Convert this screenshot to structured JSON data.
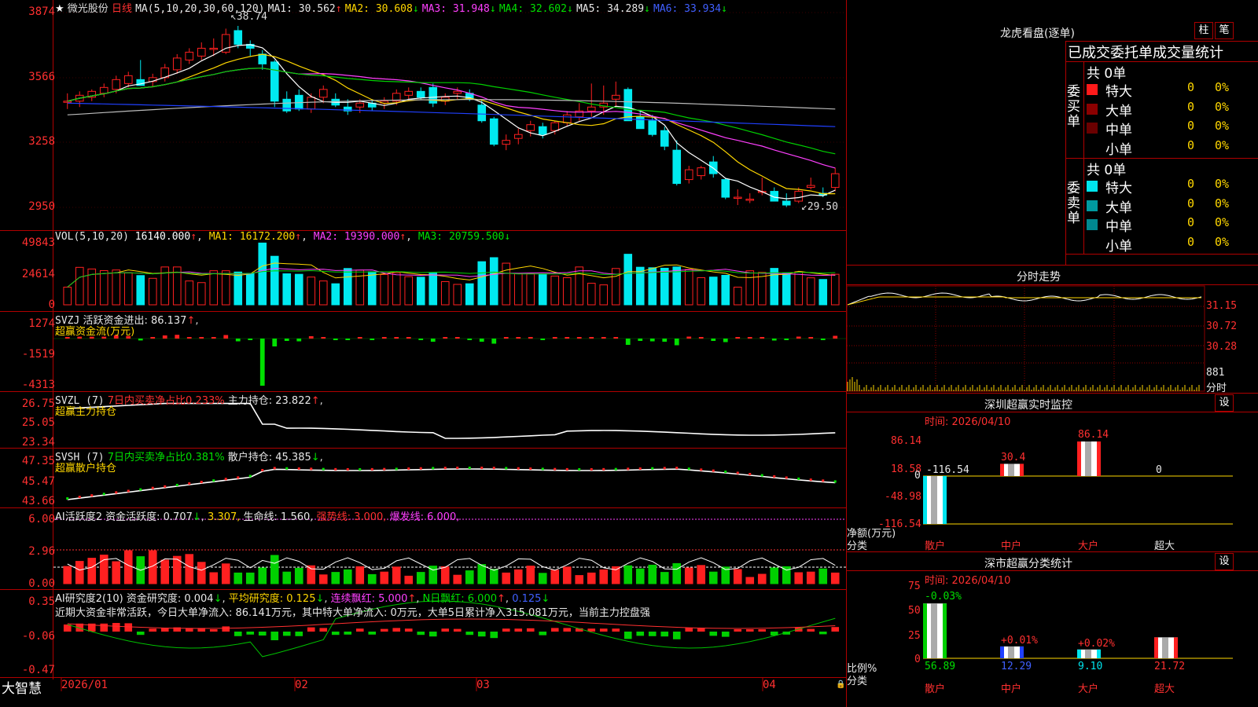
{
  "header": {
    "stock_name": "微光股份",
    "period": "日线",
    "ma_params": "MA(5,10,20,30,60,120)",
    "ma": [
      {
        "label": "MA1:",
        "value": "30.562",
        "arrow": "↑"
      },
      {
        "label": "MA2:",
        "value": "30.608",
        "arrow": "↓"
      },
      {
        "label": "MA3:",
        "value": "31.948",
        "arrow": "↓"
      },
      {
        "label": "MA4:",
        "value": "32.602",
        "arrow": "↓"
      },
      {
        "label": "MA5:",
        "value": "34.289",
        "arrow": "↓"
      },
      {
        "label": "MA6:",
        "value": "33.934",
        "arrow": "↓"
      }
    ],
    "high_marker": "38.74",
    "low_marker": "29.50"
  },
  "price_axis": [
    "3874",
    "3566",
    "3258",
    "2950"
  ],
  "vol": {
    "title": "VOL(5,10,20)",
    "value": "16140.000",
    "ma1": "MA1: 16172.200",
    "ma2": "MA2: 19390.000",
    "ma3": "MA3: 20759.500",
    "axis": [
      "49843",
      "24614",
      "0"
    ]
  },
  "svzj": {
    "title": "SVZJ",
    "line1": "活跃资金进出: 86.137",
    "line2": "超赢资金流(万元)",
    "axis": [
      "1274",
      "-1519",
      "-4313"
    ]
  },
  "svzl": {
    "title": "SVZL (7)",
    "desc": "7日内买卖净占比0.233%",
    "hold": "主力持仓: 23.822",
    "line2": "超赢主力持仓",
    "axis": [
      "26.75",
      "25.05",
      "23.34"
    ]
  },
  "svsh": {
    "title": "SVSH (7)",
    "desc": "7日内买卖净占比0.381%",
    "hold": "散户持仓: 45.385",
    "line2": "超赢散户持仓",
    "axis": [
      "47.35",
      "45.47",
      "43.66"
    ]
  },
  "ai_active": {
    "title": "AI活跃度2",
    "a1": "资金活跃度: 0.707",
    "a2": "3.307,",
    "a3": "生命线: 1.560,",
    "a4": "强势线: 3.000,",
    "a5": "爆发线: 6.000,",
    "axis": [
      "6.00",
      "2.96",
      "0.00"
    ]
  },
  "ai_research": {
    "title": "AI研究度2(10)",
    "b1": "资金研究度: 0.004",
    "b2": "平均研究度: 0.125",
    "b3": "连续飘红: 5.000",
    "b4": "N日飘红: 6.000",
    "b5": "0.125",
    "comment": "近期大资金非常活跃，今日大单净流入: 86.141万元，其中特大单净流入: 0万元，大单5日累计净入315.081万元，当前主力控盘强",
    "axis": [
      "0.35",
      "-0.06",
      "-0.47"
    ]
  },
  "date_axis": [
    "2026/01",
    "02",
    "03",
    "04"
  ],
  "brand": "大智慧",
  "right_panel": {
    "dragon_title": "龙虎看盘(逐单)",
    "btn_zhu": "柱",
    "btn_bi": "笔",
    "table_title": "已成交委托单成交量统计",
    "buy_label": "委买单",
    "sell_label": "委卖单",
    "buy_total": "共 0单",
    "sell_total": "共 0单",
    "rows": [
      {
        "name": "特大",
        "count": "0",
        "pct": "0%"
      },
      {
        "name": "大单",
        "count": "0",
        "pct": "0%"
      },
      {
        "name": "中单",
        "count": "0",
        "pct": "0%"
      },
      {
        "name": "小单",
        "count": "0",
        "pct": "0%"
      }
    ],
    "timeshare_title": "分时走势",
    "ts_axis": [
      "31.15",
      "30.72",
      "30.28",
      "881",
      "分时"
    ],
    "sz_title": "深圳超赢实时监控",
    "sz_set": "设",
    "sz_time": "时间: 2026/04/10",
    "sz_axis": [
      "86.14",
      "18.58",
      "0",
      "-48.98",
      "-116.54"
    ],
    "sz_values": {
      "sanhu": "-116.54",
      "zhonghu": "30.4",
      "dahu": "86.14",
      "chaoda": "0"
    },
    "sz_ylabel": "净额(万元)",
    "sz_xlabel": "分类",
    "cats": [
      "散户",
      "中户",
      "大户",
      "超大"
    ],
    "sh_title": "深市超赢分类统计",
    "sh_set": "设",
    "sh_time": "时间: 2026/04/10",
    "sh_axis": [
      "75",
      "50",
      "25",
      "0"
    ],
    "sh_changes": [
      "-0.03%",
      "+0.01%",
      "+0.02%"
    ],
    "sh_values": [
      "56.89",
      "12.29",
      "9.10",
      "21.72"
    ],
    "sh_ylabel": "比例%",
    "sh_xlabel": "分类"
  },
  "colors": {
    "up": "#ff2020",
    "down": "#00eaf0",
    "frame": "#b00000"
  },
  "chart_data": [
    {
      "type": "candlestick",
      "title": "微光股份 日线",
      "ylim": [
        29.0,
        39.5
      ],
      "ohlc": [
        [
          34.9,
          35.3,
          34.5,
          34.9
        ],
        [
          34.9,
          35.4,
          34.6,
          35.2
        ],
        [
          35.1,
          35.5,
          34.9,
          35.4
        ],
        [
          35.3,
          35.8,
          35.1,
          35.6
        ],
        [
          35.5,
          36.2,
          35.3,
          36.0
        ],
        [
          35.8,
          36.4,
          35.6,
          36.2
        ],
        [
          36.0,
          37.0,
          35.9,
          35.7
        ],
        [
          35.9,
          36.3,
          35.6,
          36.1
        ],
        [
          36.1,
          36.8,
          35.9,
          36.6
        ],
        [
          36.5,
          37.3,
          36.3,
          37.1
        ],
        [
          37.0,
          37.6,
          36.8,
          37.4
        ],
        [
          37.2,
          37.9,
          37.0,
          37.6
        ],
        [
          37.6,
          38.1,
          37.2,
          37.6
        ],
        [
          37.4,
          38.6,
          37.3,
          38.3
        ],
        [
          38.5,
          38.74,
          37.6,
          37.8
        ],
        [
          37.8,
          38.0,
          37.2,
          37.6
        ],
        [
          37.3,
          37.5,
          36.5,
          36.8
        ],
        [
          36.9,
          37.0,
          34.6,
          34.9
        ],
        [
          35.0,
          35.4,
          34.3,
          34.4
        ],
        [
          35.2,
          35.5,
          34.4,
          34.5
        ],
        [
          34.5,
          35.3,
          34.3,
          35.1
        ],
        [
          35.1,
          35.7,
          34.8,
          35.5
        ],
        [
          35.0,
          35.3,
          34.6,
          34.7
        ],
        [
          34.6,
          35.0,
          34.2,
          34.4
        ],
        [
          34.6,
          35.0,
          34.3,
          34.8
        ],
        [
          34.8,
          35.0,
          34.4,
          34.6
        ],
        [
          34.8,
          35.1,
          34.5,
          34.9
        ],
        [
          34.9,
          35.5,
          34.7,
          35.3
        ],
        [
          35.2,
          35.6,
          34.9,
          35.4
        ],
        [
          35.4,
          35.6,
          35.0,
          35.1
        ],
        [
          35.6,
          35.8,
          34.6,
          34.8
        ],
        [
          34.9,
          35.3,
          34.7,
          35.1
        ],
        [
          35.3,
          35.6,
          35.0,
          35.4
        ],
        [
          35.3,
          35.5,
          34.9,
          35.0
        ],
        [
          34.7,
          35.0,
          33.8,
          33.9
        ],
        [
          34.0,
          34.1,
          32.6,
          32.7
        ],
        [
          32.7,
          33.2,
          32.4,
          32.9
        ],
        [
          33.0,
          33.5,
          32.7,
          33.2
        ],
        [
          33.4,
          33.9,
          33.1,
          33.7
        ],
        [
          33.6,
          33.8,
          33.0,
          33.2
        ],
        [
          33.4,
          33.9,
          33.2,
          33.8
        ],
        [
          33.8,
          34.4,
          33.6,
          34.2
        ],
        [
          34.1,
          34.8,
          33.9,
          34.4
        ],
        [
          34.4,
          35.8,
          34.1,
          34.6
        ],
        [
          34.6,
          35.7,
          34.2,
          34.8
        ],
        [
          35.0,
          35.9,
          34.6,
          35.2
        ],
        [
          35.5,
          35.6,
          33.9,
          33.9
        ],
        [
          34.1,
          34.4,
          33.5,
          33.5
        ],
        [
          33.9,
          34.2,
          33.1,
          33.2
        ],
        [
          33.4,
          33.6,
          32.4,
          32.6
        ],
        [
          32.4,
          32.9,
          30.6,
          30.7
        ],
        [
          30.9,
          31.6,
          30.7,
          31.4
        ],
        [
          31.1,
          31.6,
          30.9,
          31.5
        ],
        [
          31.8,
          32.1,
          31.0,
          31.2
        ],
        [
          30.9,
          31.0,
          29.9,
          30.0
        ],
        [
          30.0,
          30.4,
          29.6,
          30.0
        ],
        [
          29.9,
          30.2,
          29.7,
          29.9
        ],
        [
          30.3,
          31.0,
          30.1,
          30.3
        ],
        [
          30.3,
          30.5,
          29.8,
          29.8
        ],
        [
          29.8,
          30.2,
          29.5,
          29.6
        ],
        [
          29.8,
          30.5,
          29.7,
          30.3
        ],
        [
          30.5,
          31.0,
          30.4,
          30.6
        ],
        [
          30.2,
          30.5,
          30.0,
          30.1
        ],
        [
          30.5,
          31.5,
          30.3,
          31.2
        ]
      ],
      "xlabels": [
        "2026/01",
        "02",
        "03",
        "04"
      ]
    },
    {
      "type": "bar",
      "title": "VOL(5,10,20)",
      "ylim": [
        0,
        49843
      ]
    }
  ]
}
